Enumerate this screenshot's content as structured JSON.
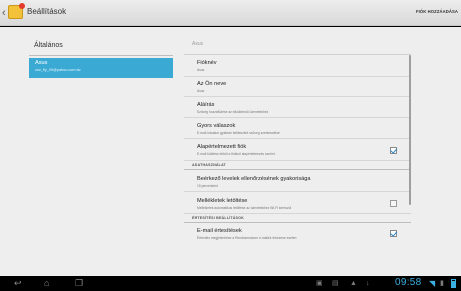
{
  "titlebar": {
    "title": "Beállítások",
    "action": "FIÓK HOZZÁADÁSA",
    "icon": "mail-app-icon"
  },
  "left_pane": {
    "header": "Általános",
    "account": {
      "name": "Asus",
      "email": "zoz_fly_09@yahoo.com.tw"
    }
  },
  "right_pane": {
    "header": "Asus",
    "items": [
      {
        "title": "Fióknév",
        "subtitle": "Asus"
      },
      {
        "title": "Az Ön neve",
        "subtitle": "Asus"
      },
      {
        "title": "Aláírás",
        "subtitle": "Szöveg hozzáfűzése az elküldendő üzenetekhez"
      },
      {
        "title": "Gyors válaszok",
        "subtitle": "E-mail írásakor gyakran beilleszteít szöveg szerkesztése"
      },
      {
        "title": "Alapértelmezett fiók",
        "subtitle": "E-mail küldése ebből a fiókból alapértelmezés szerint",
        "checked": true
      }
    ],
    "section_data": {
      "label": "ADATHASZNÁLAT",
      "items": [
        {
          "title": "Beérkező levelek ellenőrzésének gyakorisága",
          "subtitle": "15 percenként"
        },
        {
          "title": "Mellékletek letöltése",
          "subtitle": "Mellékletek automatikus letöltése az üzenetekhez Wi-Fi kereszül",
          "checked": false
        }
      ]
    },
    "section_notify": {
      "label": "ÉRTESÍTÉSI BEÁLLÍTÁSOK",
      "items": [
        {
          "title": "E-mail értesítések",
          "subtitle": "Értesítés megjelenítése a Rendszersávon e-mailek érkezése esetén",
          "checked": true
        }
      ]
    }
  },
  "statusbar": {
    "clock": "09:58",
    "nav_icons": [
      "back-icon",
      "home-icon",
      "recent-apps-icon"
    ],
    "status_icons": [
      "screenshot-icon",
      "gallery-icon",
      "warning-icon",
      "usb-icon",
      "wifi-icon",
      "signal-icon",
      "battery-icon"
    ]
  },
  "colors": {
    "accent": "#3aaad4",
    "clock": "#3ab0e2",
    "checkbox_check": "#2c86c4"
  }
}
